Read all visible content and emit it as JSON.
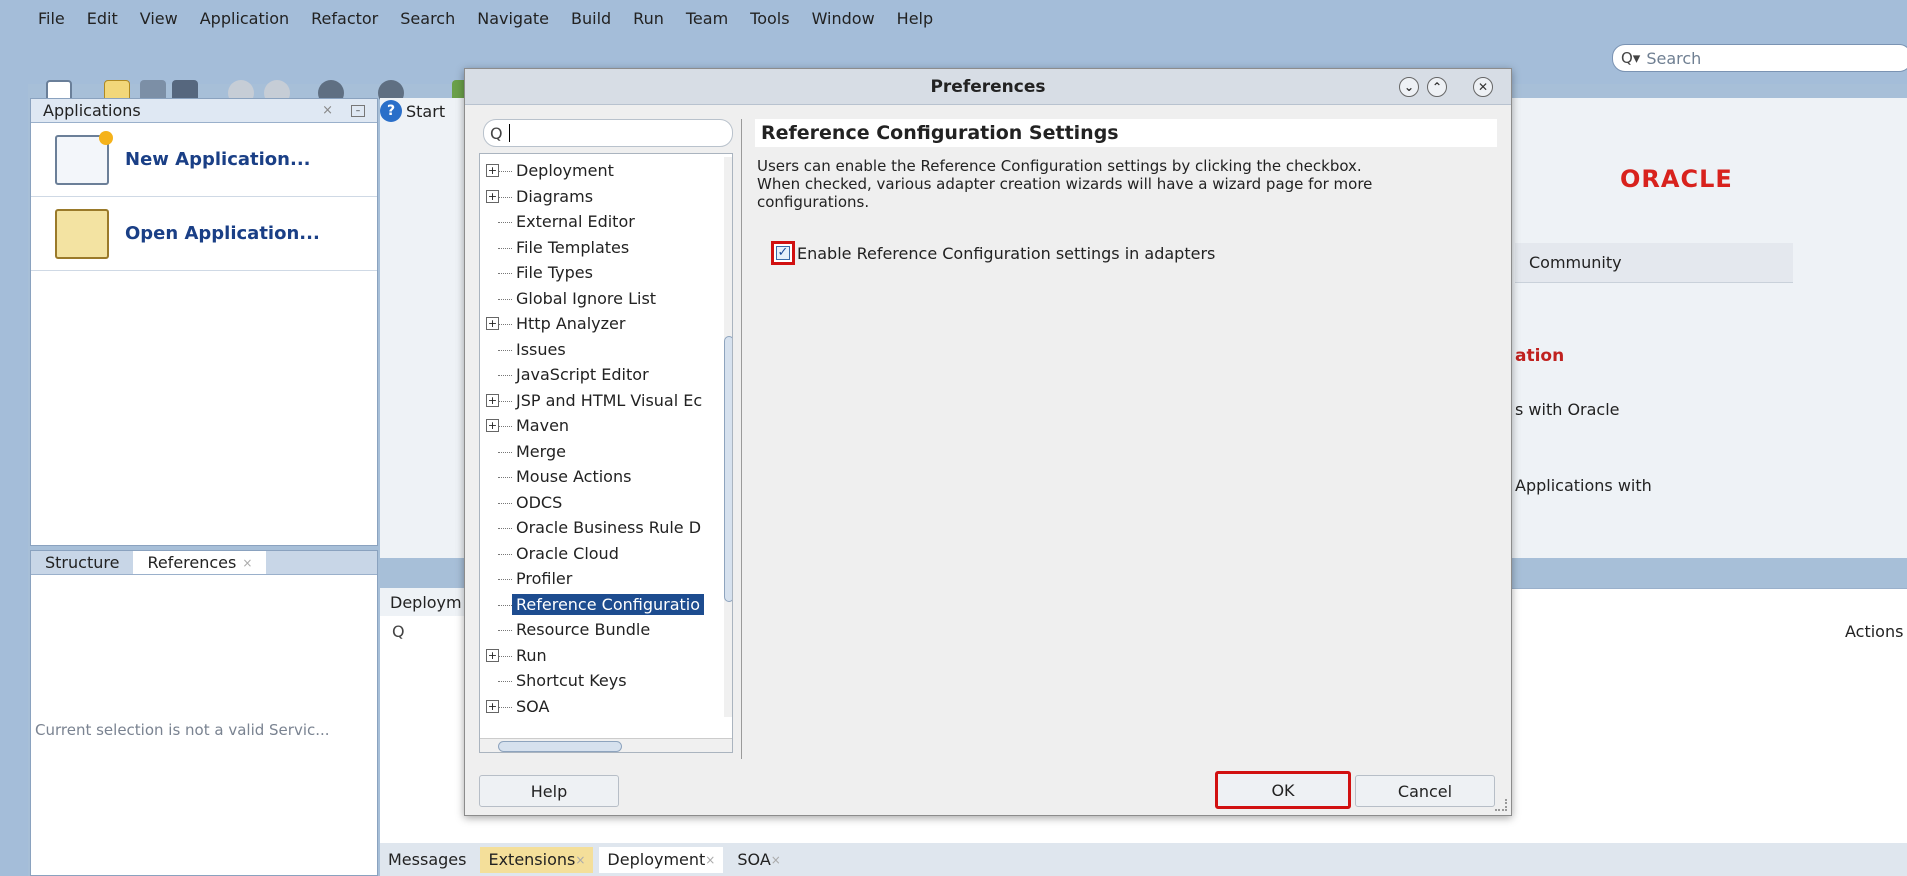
{
  "menu": [
    {
      "label": "File",
      "underline": "F",
      "rest": "ile"
    },
    {
      "label": "Edit",
      "underline": "E",
      "rest": "dit"
    },
    {
      "label": "View",
      "underline": "V",
      "rest": "iew"
    },
    {
      "label": "Application",
      "underline": "A",
      "rest": "pplication"
    },
    {
      "label": "Refactor",
      "pre": "Refa",
      "underline": "c",
      "rest": "tor"
    },
    {
      "label": "Search",
      "underline": "S",
      "rest": "earch"
    },
    {
      "label": "Navigate",
      "underline": "N",
      "rest": "avigate"
    },
    {
      "label": "Build",
      "underline": "B",
      "rest": "uild"
    },
    {
      "label": "Run",
      "underline": "R",
      "rest": "un"
    },
    {
      "label": "Team",
      "pre": "Tea",
      "underline": "m",
      "rest": ""
    },
    {
      "label": "Tools",
      "underline": "T",
      "rest": "ools"
    },
    {
      "label": "Window",
      "underline": "W",
      "rest": "indow"
    },
    {
      "label": "Help",
      "underline": "H",
      "rest": "elp"
    }
  ],
  "search_top": {
    "placeholder": "Search"
  },
  "applications": {
    "tab_label": "Applications",
    "new_app": "New Application...",
    "open_app": "Open Application..."
  },
  "structure": {
    "tab_structure": "Structure",
    "tab_references": "References",
    "message": "Current selection is not a valid Servic..."
  },
  "center": {
    "start_tab": "Start",
    "oracle_logo": "ORACLE",
    "community_tab": "Community",
    "ation_text": "ation",
    "with_oracle_text": "s with Oracle",
    "applications_with_text": "Applications with",
    "deployment_tab": "Deploym",
    "actions_label": "Actions"
  },
  "bottom_tabs": [
    "Messages",
    "Extensions",
    "Deployment",
    "SOA"
  ],
  "dialog": {
    "title": "Preferences",
    "search_value": "",
    "tree": [
      {
        "label": "Deployment",
        "expandable": true,
        "selected": false
      },
      {
        "label": "Diagrams",
        "expandable": true,
        "selected": false
      },
      {
        "label": "External Editor",
        "expandable": false,
        "selected": false
      },
      {
        "label": "File Templates",
        "expandable": false,
        "selected": false
      },
      {
        "label": "File Types",
        "expandable": false,
        "selected": false
      },
      {
        "label": "Global Ignore List",
        "expandable": false,
        "selected": false
      },
      {
        "label": "Http Analyzer",
        "expandable": true,
        "selected": false
      },
      {
        "label": "Issues",
        "expandable": false,
        "selected": false
      },
      {
        "label": "JavaScript Editor",
        "expandable": false,
        "selected": false
      },
      {
        "label": "JSP and HTML Visual Ec",
        "expandable": true,
        "selected": false
      },
      {
        "label": "Maven",
        "expandable": true,
        "selected": false
      },
      {
        "label": "Merge",
        "expandable": false,
        "selected": false
      },
      {
        "label": "Mouse Actions",
        "expandable": false,
        "selected": false
      },
      {
        "label": "ODCS",
        "expandable": false,
        "selected": false
      },
      {
        "label": "Oracle Business Rule D",
        "expandable": false,
        "selected": false
      },
      {
        "label": "Oracle Cloud",
        "expandable": false,
        "selected": false
      },
      {
        "label": "Profiler",
        "expandable": false,
        "selected": false
      },
      {
        "label": "Reference Configuratio",
        "expandable": false,
        "selected": true
      },
      {
        "label": "Resource Bundle",
        "expandable": false,
        "selected": false
      },
      {
        "label": "Run",
        "expandable": true,
        "selected": false
      },
      {
        "label": "Shortcut Keys",
        "expandable": false,
        "selected": false
      },
      {
        "label": "SOA",
        "expandable": true,
        "selected": false
      }
    ],
    "settings_title": "Reference Configuration Settings",
    "settings_desc_line1": "Users can enable the Reference Configuration settings by clicking the checkbox.",
    "settings_desc_line2": "When checked, various adapter creation wizards will have a wizard page for more",
    "settings_desc_line3": "configurations.",
    "checkbox_label": "Enable Reference Configuration settings in adapters",
    "checkbox_checked": true,
    "help_button": "Help",
    "ok_button": "OK",
    "cancel_button": "Cancel"
  },
  "colors": {
    "highlight": "#d11010",
    "selection": "#1d4c8f",
    "oracle_red": "#d8221d"
  }
}
